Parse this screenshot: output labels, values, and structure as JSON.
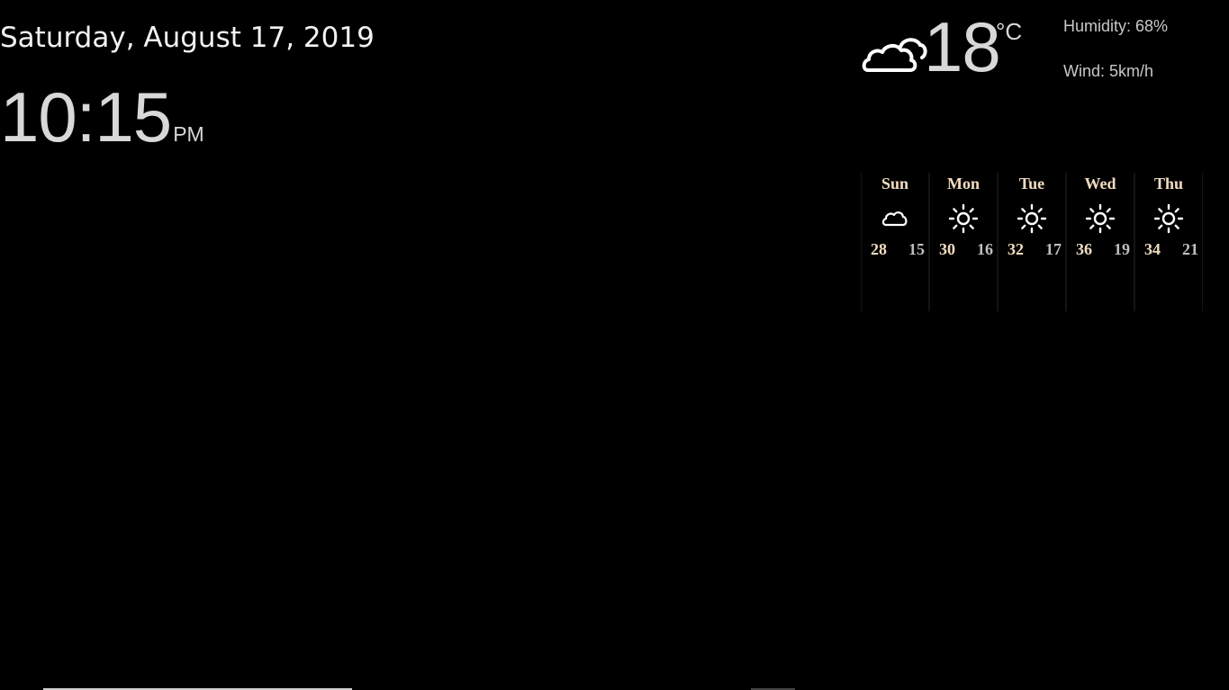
{
  "clock": {
    "date": "Saturday, August 17, 2019",
    "time": "10:15",
    "ampm": "PM"
  },
  "current": {
    "icon": "cloudy-icon",
    "temperature": "18",
    "unit": "°C",
    "humidity": "Humidity: 68%",
    "wind": "Wind: 5km/h"
  },
  "forecast": [
    {
      "day": "Sun",
      "icon": "cloud-icon",
      "high": "28",
      "low": "15"
    },
    {
      "day": "Mon",
      "icon": "sun-icon",
      "high": "30",
      "low": "16"
    },
    {
      "day": "Tue",
      "icon": "sun-icon",
      "high": "32",
      "low": "17"
    },
    {
      "day": "Wed",
      "icon": "sun-icon",
      "high": "36",
      "low": "19"
    },
    {
      "day": "Thu",
      "icon": "sun-icon",
      "high": "34",
      "low": "21"
    }
  ],
  "colors": {
    "background": "#000000",
    "accent": "#f0dcc0",
    "text": "#d8d8d8"
  }
}
